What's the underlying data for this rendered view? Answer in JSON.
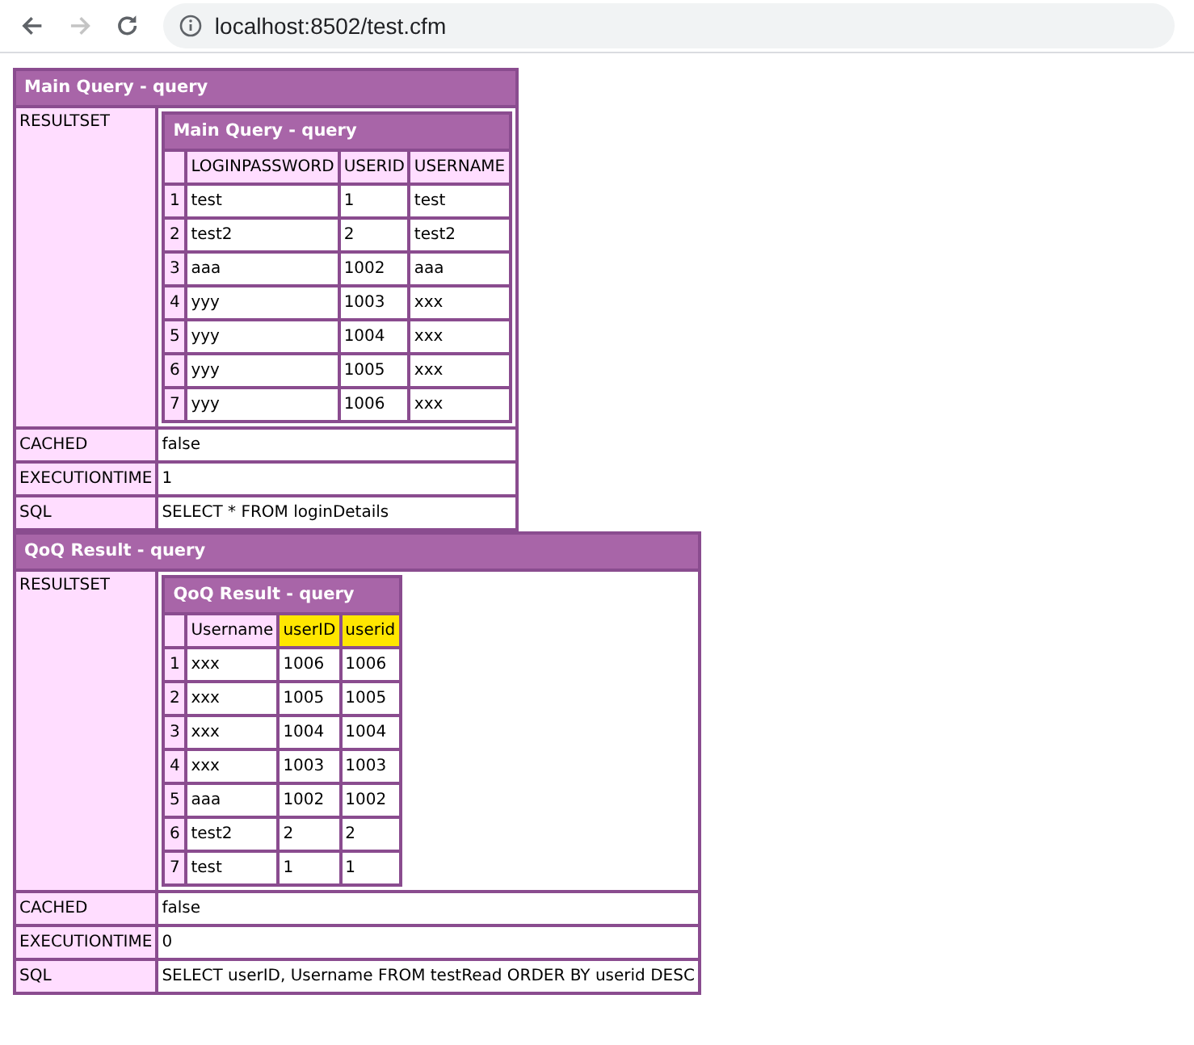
{
  "browser": {
    "url": "localhost:8502/test.cfm",
    "back_enabled": true,
    "forward_enabled": false
  },
  "dumps": [
    {
      "title": "Main Query - query",
      "resultset": {
        "title": "Main Query - query",
        "columns": [
          {
            "label": "LOGINPASSWORD",
            "highlighted": false
          },
          {
            "label": "USERID",
            "highlighted": false
          },
          {
            "label": "USERNAME",
            "highlighted": false
          }
        ],
        "rows": [
          {
            "index": "1",
            "cells": [
              "test",
              "1",
              "test"
            ]
          },
          {
            "index": "2",
            "cells": [
              "test2",
              "2",
              "test2"
            ]
          },
          {
            "index": "3",
            "cells": [
              "aaa",
              "1002",
              "aaa"
            ]
          },
          {
            "index": "4",
            "cells": [
              "yyy",
              "1003",
              "xxx"
            ]
          },
          {
            "index": "5",
            "cells": [
              "yyy",
              "1004",
              "xxx"
            ]
          },
          {
            "index": "6",
            "cells": [
              "yyy",
              "1005",
              "xxx"
            ]
          },
          {
            "index": "7",
            "cells": [
              "yyy",
              "1006",
              "xxx"
            ]
          }
        ]
      },
      "resultset_label": "RESULTSET",
      "fields": [
        {
          "label": "CACHED",
          "value": "false"
        },
        {
          "label": "EXECUTIONTIME",
          "value": "1"
        },
        {
          "label": "SQL",
          "value": "SELECT * FROM loginDetails"
        }
      ]
    },
    {
      "title": "QoQ Result - query",
      "resultset": {
        "title": "QoQ Result - query",
        "columns": [
          {
            "label": "Username",
            "highlighted": false
          },
          {
            "label": "userID",
            "highlighted": true
          },
          {
            "label": "userid",
            "highlighted": true
          }
        ],
        "rows": [
          {
            "index": "1",
            "cells": [
              "xxx",
              "1006",
              "1006"
            ]
          },
          {
            "index": "2",
            "cells": [
              "xxx",
              "1005",
              "1005"
            ]
          },
          {
            "index": "3",
            "cells": [
              "xxx",
              "1004",
              "1004"
            ]
          },
          {
            "index": "4",
            "cells": [
              "xxx",
              "1003",
              "1003"
            ]
          },
          {
            "index": "5",
            "cells": [
              "aaa",
              "1002",
              "1002"
            ]
          },
          {
            "index": "6",
            "cells": [
              "test2",
              "2",
              "2"
            ]
          },
          {
            "index": "7",
            "cells": [
              "test",
              "1",
              "1"
            ]
          }
        ]
      },
      "resultset_label": "RESULTSET",
      "fields": [
        {
          "label": "CACHED",
          "value": "false"
        },
        {
          "label": "EXECUTIONTIME",
          "value": "0"
        },
        {
          "label": "SQL",
          "value": "SELECT userID, Username FROM testRead ORDER BY userid DESC"
        }
      ]
    }
  ]
}
